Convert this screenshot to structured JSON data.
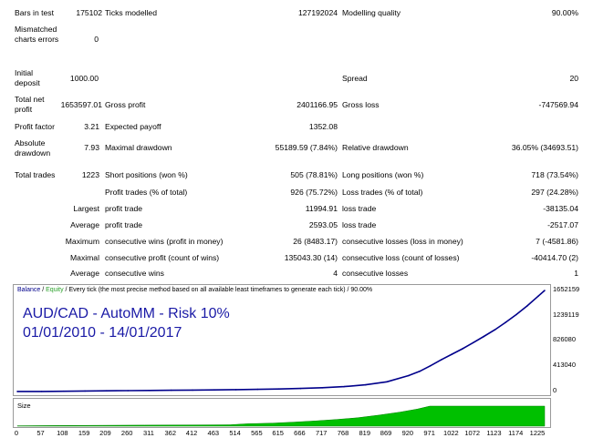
{
  "report": {
    "bars_label": "Bars in test",
    "bars_value": "175102",
    "ticks_label": "Ticks modelled",
    "ticks_value": "127192024",
    "quality_label": "Modelling quality",
    "quality_value": "90.00%",
    "mismatch_label": "Mismatched charts errors",
    "mismatch_value": "0",
    "deposit_label": "Initial deposit",
    "deposit_value": "1000.00",
    "spread_label": "Spread",
    "spread_value": "20",
    "netprofit_label": "Total net profit",
    "netprofit_value": "1653597.01",
    "grossprofit_label": "Gross profit",
    "grossprofit_value": "2401166.95",
    "grossloss_label": "Gross loss",
    "grossloss_value": "-747569.94",
    "pf_label": "Profit factor",
    "pf_value": "3.21",
    "payoff_label": "Expected payoff",
    "payoff_value": "1352.08",
    "absdd_label": "Absolute drawdown",
    "absdd_value": "7.93",
    "maxdd_label": "Maximal drawdown",
    "maxdd_value": "55189.59 (7.84%)",
    "reldd_label": "Relative drawdown",
    "reldd_value": "36.05% (34693.51)",
    "trades_label": "Total trades",
    "trades_value": "1223",
    "short_label": "Short positions (won %)",
    "short_value": "505 (78.81%)",
    "long_label": "Long positions (won %)",
    "long_value": "718 (73.54%)",
    "ptrades_label": "Profit trades (% of total)",
    "ptrades_value": "926 (75.72%)",
    "ltrades_label": "Loss trades (% of total)",
    "ltrades_value": "297 (24.28%)",
    "largest_prefix": "Largest",
    "largest_profit_label": "profit trade",
    "largest_profit_value": "11994.91",
    "largest_loss_label": "loss trade",
    "largest_loss_value": "-38135.04",
    "average_prefix": "Average",
    "avg_profit_label": "profit trade",
    "avg_profit_value": "2593.05",
    "avg_loss_label": "loss trade",
    "avg_loss_value": "-2517.07",
    "maximum_prefix": "Maximum",
    "max_wins_label": "consecutive wins (profit in money)",
    "max_wins_value": "26 (8483.17)",
    "max_losses_label": "consecutive losses (loss in money)",
    "max_losses_value": "7 (-4581.86)",
    "maximal_prefix": "Maximal",
    "mxl_profit_label": "consecutive profit (count of wins)",
    "mxl_profit_value": "135043.30 (14)",
    "mxl_loss_label": "consecutive loss (count of losses)",
    "mxl_loss_value": "-40414.70 (2)",
    "average2_prefix": "Average",
    "avg_wins_label": "consecutive wins",
    "avg_wins_value": "4",
    "avg_losses_label": "consecutive losses",
    "avg_losses_value": "1"
  },
  "chart": {
    "legend_balance": "Balance",
    "legend_sep1": " / ",
    "legend_equity": "Equity",
    "legend_rest": " / Every tick (the most precise method based on all available least timeframes to generate each tick) / 90.00%",
    "title_line1": "AUD/CAD - AutoMM - Risk 10%",
    "title_line2": "01/01/2010 - 14/01/2017",
    "size_label": "Size",
    "balance_color": "#00008b",
    "equity_color": "#2aa12a",
    "size_color": "#00c000"
  },
  "chart_data": {
    "type": "line",
    "series": [
      {
        "name": "Balance",
        "x": [
          0,
          57,
          108,
          159,
          209,
          260,
          311,
          362,
          412,
          463,
          514,
          565,
          615,
          666,
          717,
          768,
          819,
          869,
          920,
          946,
          971,
          997,
          1022,
          1047,
          1072,
          1097,
          1123,
          1148,
          1174,
          1199,
          1225,
          1240
        ],
        "values": [
          1000,
          2000,
          5000,
          9000,
          12000,
          15000,
          18000,
          21000,
          24000,
          27000,
          31000,
          36000,
          42000,
          50000,
          62000,
          80000,
          110000,
          160000,
          260000,
          330000,
          420000,
          520000,
          610000,
          700000,
          800000,
          900000,
          1010000,
          1130000,
          1260000,
          1400000,
          1560000,
          1652159
        ]
      },
      {
        "name": "Size",
        "x": [
          0,
          100,
          200,
          300,
          400,
          500,
          540,
          600,
          650,
          700,
          750,
          800,
          850,
          900,
          940,
          970,
          1240
        ],
        "values": [
          0.02,
          0.03,
          0.04,
          0.05,
          0.06,
          0.07,
          0.12,
          0.15,
          0.2,
          0.26,
          0.33,
          0.42,
          0.55,
          0.7,
          0.85,
          1,
          1
        ]
      }
    ],
    "x_ticks": [
      "0",
      "57",
      "108",
      "159",
      "209",
      "260",
      "311",
      "362",
      "412",
      "463",
      "514",
      "565",
      "615",
      "666",
      "717",
      "768",
      "819",
      "869",
      "920",
      "971",
      "1022",
      "1072",
      "1123",
      "1174",
      "1225"
    ],
    "y_ticks": [
      "1652159",
      "1239119",
      "826080",
      "413040",
      "0"
    ],
    "xlim": [
      0,
      1240
    ],
    "ylim": [
      0,
      1652159
    ],
    "grid": false
  }
}
